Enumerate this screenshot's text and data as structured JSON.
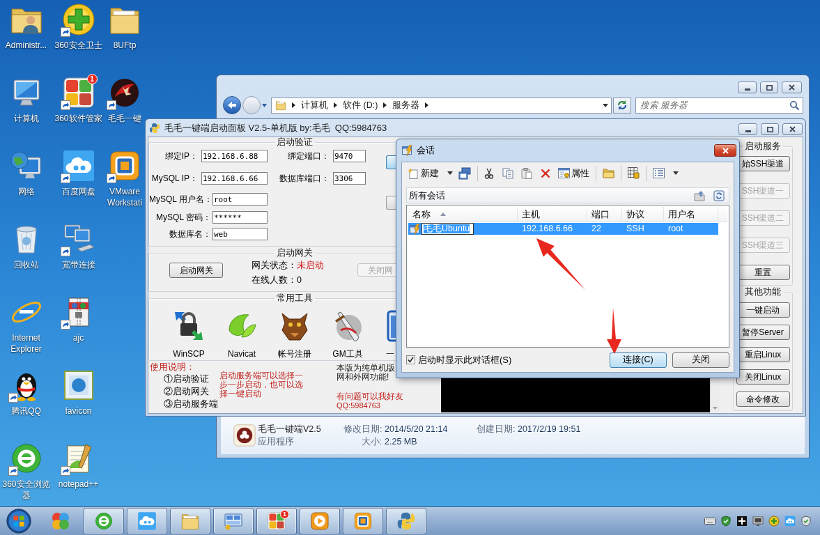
{
  "desktop": {
    "rows": [
      [
        {
          "label": "Administr...",
          "shortcut": false
        },
        {
          "label": "360安全卫士",
          "shortcut": true
        },
        {
          "label": "8UFtp",
          "shortcut": false
        }
      ],
      [
        {
          "label": "计算机",
          "shortcut": false
        },
        {
          "label": "360软件管家",
          "shortcut": true,
          "badge": "1"
        },
        {
          "label": "毛毛一键",
          "shortcut": true
        }
      ],
      [
        {
          "label": "网络",
          "shortcut": false
        },
        {
          "label": "百度网盘",
          "shortcut": true
        },
        {
          "label": "VMware Workstati",
          "shortcut": true
        }
      ],
      [
        {
          "label": "回收站",
          "shortcut": false
        },
        {
          "label": "宽带连接",
          "shortcut": true
        }
      ],
      [
        {
          "label": "Internet Explorer",
          "shortcut": false
        },
        {
          "label": "ajc",
          "shortcut": true
        }
      ],
      [
        {
          "label": "腾讯QQ",
          "shortcut": true
        },
        {
          "label": "favicon",
          "shortcut": false
        }
      ],
      [
        {
          "label": "360安全浏览器",
          "shortcut": true
        },
        {
          "label": "notepad++",
          "shortcut": true
        }
      ]
    ]
  },
  "explorer": {
    "breadcrumb": [
      "计算机",
      "软件 (D:)",
      "服务器"
    ],
    "search": {
      "placeholder": "搜索 服务器"
    },
    "details": {
      "name": "毛毛一键端V2.5",
      "type": "应用程序",
      "columns": [
        [
          {
            "label": "修改日期:",
            "value": "2014/5/20 21:14"
          },
          {
            "label": "大小:",
            "value": "2.25 MB"
          }
        ],
        [
          {
            "label": "创建日期:",
            "value": "2017/2/19 19:51"
          }
        ]
      ]
    }
  },
  "panel": {
    "title": "毛毛一键端启动面板 V2.5-单机版 by:毛毛  QQ:5984763",
    "verify": {
      "title": "启动验证",
      "rows": [
        [
          {
            "label": "绑定IP：",
            "value": "192.168.6.88"
          },
          {
            "label": "绑定端口：",
            "value": "9470"
          }
        ],
        [
          {
            "label": "MySQL IP：",
            "value": "192.168.6.66"
          },
          {
            "label": "数据库端口：",
            "value": "3306"
          }
        ],
        [
          {
            "label": "MySQL 用户名：",
            "value": "root"
          }
        ],
        [
          {
            "label": "MySQL 密码：",
            "value": "******"
          }
        ],
        [
          {
            "label": "数据库名：",
            "value": "web"
          }
        ]
      ],
      "side_buttons": [
        {
          "default": true
        },
        {
          "default": false
        }
      ]
    },
    "gateway": {
      "title": "启动网关",
      "start_button": "启动网关",
      "status_label": "网关状态：",
      "status": "未启动",
      "running": false,
      "online": "在线人数：0",
      "stop_button": {
        "label": "关闭网",
        "disabled": true
      }
    },
    "tools": {
      "title": "常用工具",
      "items": [
        {
          "label": "WinSCP",
          "kind": "full"
        },
        {
          "label": "Navicat",
          "kind": "full"
        },
        {
          "label": "帐号注册",
          "kind": "full"
        },
        {
          "label": "GM工具",
          "kind": "full"
        },
        {
          "label": "一",
          "kind": "partial"
        }
      ]
    },
    "notes": {
      "heading": "使用说明：",
      "steps": [
        "①启动验证",
        "②启动网关",
        "③启动服务端"
      ],
      "hint": "启动服务端可以选择一步一步启动，也可以选择一键启动",
      "edition": [
        "本版为纯单机版",
        "网和外网功能!"
      ],
      "contact": "有问题可以我好友",
      "qq": "QQ:5984763"
    },
    "service": {
      "title": "启动服务",
      "buttons": [
        {
          "label": "始SSH渠道",
          "disabled": false
        },
        {
          "label": "SSH渠道一",
          "disabled": true
        },
        {
          "label": "SSH渠道二",
          "disabled": true
        },
        {
          "label": "SSH渠道三",
          "disabled": true
        },
        {
          "label": "重置",
          "disabled": false
        }
      ]
    },
    "other": {
      "title": "其他功能",
      "buttons": [
        {
          "label": "一键启动",
          "disabled": false
        },
        {
          "label": "暂停Server",
          "disabled": false
        },
        {
          "label": "重启Linux",
          "disabled": false
        },
        {
          "label": "关闭Linux",
          "disabled": false
        },
        {
          "label": "命令修改",
          "disabled": false
        }
      ]
    }
  },
  "dialog": {
    "title": "会话",
    "toolbar": {
      "new": "新建",
      "properties": "属性"
    },
    "path": "所有会话",
    "columns": [
      {
        "label": "名称",
        "sorted": true
      },
      {
        "label": "主机",
        "sorted": false
      },
      {
        "label": "端口",
        "sorted": false
      },
      {
        "label": "协议",
        "sorted": false
      },
      {
        "label": "用户名",
        "sorted": false
      }
    ],
    "rows": [
      {
        "cells": [
          "毛毛Ubuntu",
          "192.168.6.66",
          "22",
          "SSH",
          "root"
        ],
        "selected": true,
        "editing": true
      }
    ],
    "show_on_startup": {
      "label": "启动时显示此对话框(S)",
      "checked": true
    },
    "buttons": [
      {
        "label": "连接(C)",
        "default": true
      },
      {
        "label": "关闭",
        "default": false
      }
    ]
  },
  "taskbar": {
    "items": [
      {
        "running": false
      },
      {
        "running": true
      },
      {
        "running": true
      },
      {
        "running": true
      },
      {
        "running": true
      },
      {
        "running": true,
        "badge": "1"
      },
      {
        "running": true
      },
      {
        "running": true
      },
      {
        "running": true
      }
    ]
  }
}
